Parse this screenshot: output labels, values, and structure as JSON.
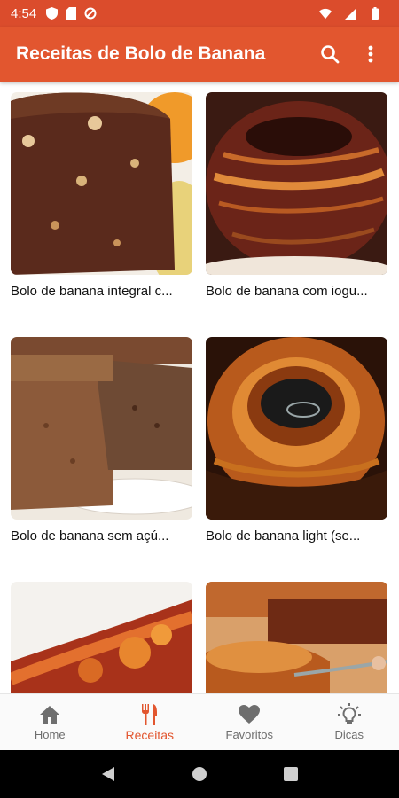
{
  "status_bar": {
    "time": "4:54"
  },
  "app_bar": {
    "title": "Receitas de Bolo de Banana"
  },
  "recipes": [
    {
      "label": "Bolo de banana integral c..."
    },
    {
      "label": "Bolo de banana com iogu..."
    },
    {
      "label": "Bolo de banana sem açú..."
    },
    {
      "label": "Bolo de banana light (se..."
    },
    {
      "label": ""
    },
    {
      "label": ""
    }
  ],
  "bottom_nav": {
    "items": [
      {
        "label": "Home",
        "icon": "home-icon"
      },
      {
        "label": "Receitas",
        "icon": "cutlery-icon",
        "active": true
      },
      {
        "label": "Favoritos",
        "icon": "heart-icon"
      },
      {
        "label": "Dicas",
        "icon": "lightbulb-icon"
      }
    ]
  },
  "colors": {
    "primary": "#e2562f",
    "status_bar": "#db4c2c",
    "inactive": "#6e6e6e"
  }
}
